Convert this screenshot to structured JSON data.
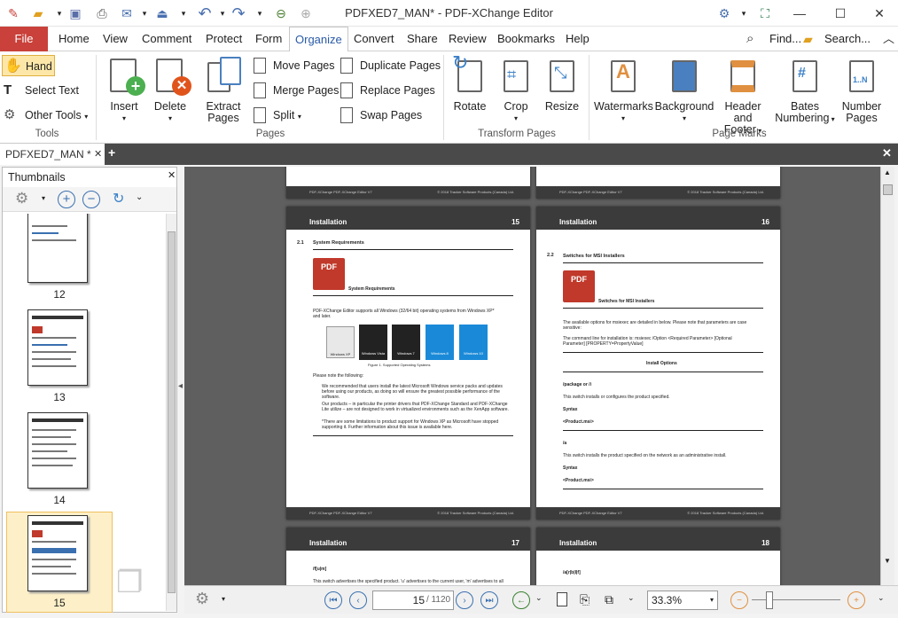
{
  "app": {
    "title": "PDFXED7_MAN* - PDF-XChange Editor"
  },
  "menu": {
    "file": "File",
    "tabs": [
      "Home",
      "View",
      "Comment",
      "Protect",
      "Form",
      "Organize",
      "Convert",
      "Share",
      "Review",
      "Bookmarks",
      "Help"
    ],
    "find": "Find...",
    "search": "Search..."
  },
  "ribbon": {
    "tools": {
      "hand": "Hand",
      "select_text": "Select Text",
      "other_tools": "Other Tools",
      "group": "Tools"
    },
    "pages": {
      "insert": "Insert",
      "delete": "Delete",
      "extract1": "Extract",
      "extract2": "Pages",
      "move": "Move Pages",
      "merge": "Merge Pages",
      "split": "Split",
      "duplicate": "Duplicate Pages",
      "replace": "Replace Pages",
      "swap": "Swap Pages",
      "group": "Pages"
    },
    "transform": {
      "rotate": "Rotate",
      "crop": "Crop",
      "resize": "Resize",
      "group": "Transform Pages"
    },
    "marks": {
      "watermarks": "Watermarks",
      "background": "Background",
      "hf1": "Header and",
      "hf2": "Footer",
      "bates1": "Bates",
      "bates2": "Numbering",
      "num1": "Number",
      "num2": "Pages",
      "group": "Page Marks"
    }
  },
  "doctab": {
    "label": "PDFXED7_MAN *"
  },
  "thumbs": {
    "title": "Thumbnails",
    "pages": [
      "12",
      "13",
      "14",
      "15"
    ]
  },
  "pages": {
    "p15": {
      "section": "Installation",
      "num": "15",
      "h": "2.1",
      "htitle": "System Requirements",
      "boxlabel": "System Requirements",
      "intro": "PDF-XChange Editor supports all Windows (32/64 bit) operating systems from Windows XP* and later.",
      "caption": "Figure 1. Supported Operating Systems",
      "note": "Please note the following:",
      "b1": "We recommended that users install the latest Microsoft Windows service packs and updates before using our products, as doing so will ensure the greatest possible performance of the software.",
      "b2": "Our products – in particular the printer drivers that PDF-XChange Standard and PDF-XChange Lite utilize – are not designed to work in virtualized environments such as the XenApp software.",
      "b3": "*There are some limitations to product support for Windows XP as Microsoft have stopped supporting it. Further information about this issue is available here."
    },
    "p16": {
      "section": "Installation",
      "num": "16",
      "h": "2.2",
      "htitle": "Switches for MSI Installers",
      "boxlabel": "Switches for MSI Installers",
      "t1": "The available options for msiexec are detailed in below. Please note that parameters are case sensitive:",
      "t2": "The command line for installation is: msiexec /Option <Required Parameter> [Optional Parameter] [PROPERTY=PropertyValue]",
      "opt": "Install Options",
      "o1": "/package or /i",
      "o1d": "This switch installs or configures the product specified.",
      "syn": "Syntax",
      "prod": "<Product.msi>",
      "o2": "/a",
      "o2d": "This switch installs the product specified on the network as an administrative install."
    },
    "p17": {
      "section": "Installation",
      "num": "17",
      "t": "/f[u|m]",
      "d": "This switch advertises the specified product. 'u' advertises to the current user, 'm' advertises to all"
    },
    "p18": {
      "section": "Installation",
      "num": "18",
      "t": "/a[r|b|l|f]"
    },
    "footer_l": "PDF-XChange PDF-XChange Editor V7",
    "footer_r": "© 2018 Tracker Software Products (Canada) Ltd."
  },
  "logos": [
    "Windows XP",
    "Windows Vista",
    "Windows 7",
    "Windows 8",
    "Windows 10"
  ],
  "status": {
    "page": "15",
    "total": "/ 1120",
    "zoom": "33.3%"
  }
}
